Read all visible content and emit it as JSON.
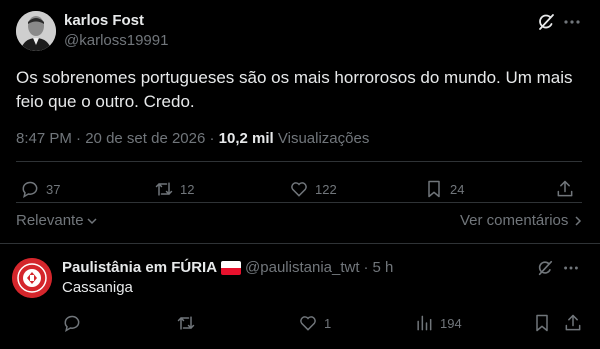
{
  "post": {
    "display_name": "karlos Fost",
    "handle": "@karloss19991",
    "text": "Os sobrenomes portugueses são os mais horrorosos do mundo. Um mais feio que o outro. Credo.",
    "time": "8:47 PM",
    "date": "20 de set de 2026",
    "dot": "·",
    "views_count": "10,2 mil",
    "views_label": "Visualizações",
    "actions": {
      "replies": "37",
      "reposts": "12",
      "likes": "122",
      "bookmarks": "24"
    }
  },
  "sort": {
    "label": "Relevante",
    "see_replies": "Ver comentários"
  },
  "reply": {
    "display_name": "Paulistânia em FÚRIA",
    "handle": "@paulistania_twt",
    "dot": "·",
    "time": "5 h",
    "text": "Cassaniga",
    "actions": {
      "replies": "",
      "reposts": "",
      "likes": "1",
      "views": "194"
    }
  },
  "icons": {
    "grok": "grok-icon",
    "more": "more-icon",
    "reply": "reply-icon",
    "repost": "repost-icon",
    "like": "heart-icon",
    "bookmark": "bookmark-icon",
    "share": "share-icon",
    "views": "views-icon"
  },
  "colors": {
    "background": "#000000",
    "text": "#e7e9ea",
    "muted": "#71767b",
    "divider": "#2f3336",
    "reply_avatar": "#d4262c"
  }
}
